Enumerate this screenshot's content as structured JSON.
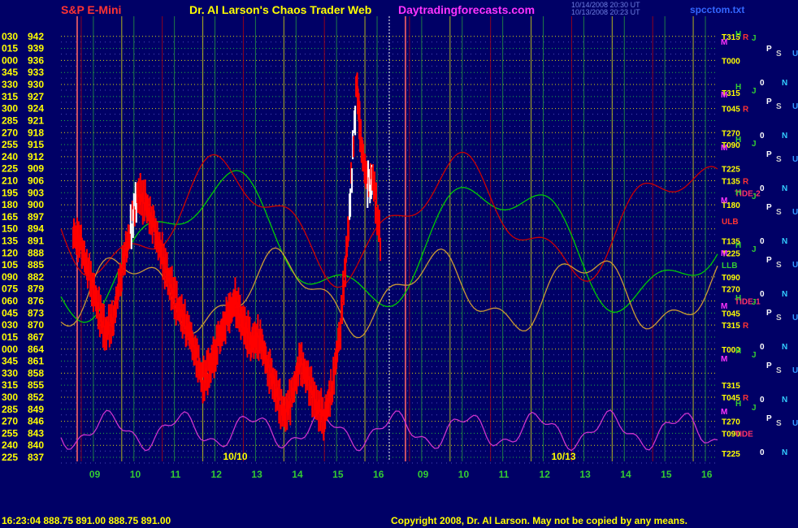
{
  "header": {
    "symbol": "S&P E-Mini",
    "title": "Dr. Al Larson's Chaos Trader Web",
    "site": "Daytradingforecasts.com",
    "timestamp_line1": "10/14/2008 20:30 UT",
    "timestamp_line2": "10/13/2008 20:23 UT",
    "filename": "spcctom.txt"
  },
  "footer": {
    "quote": "16:23:04  888.75 891.00 888.75 891.00",
    "copyright": "Copyright 2008, Dr. Al Larson. May not be copied by any means."
  },
  "colors": {
    "background": "#000066",
    "price_bars": "#ff0000",
    "up_bars": "#ffffff",
    "grid_yellow": "#ffff00",
    "grid_green": "#33cc33",
    "cycle_green": "#00cc00",
    "cycle_red": "#cc0000",
    "cycle_magenta": "#cc33cc",
    "axis_text": "#ffff00",
    "hour_text": "#33cc33"
  },
  "chart_data": {
    "type": "line",
    "title": "S&P E-Mini",
    "y_range": [
      837,
      945
    ],
    "y_tick_labels": [
      {
        "angle": "030",
        "price": "942"
      },
      {
        "angle": "015",
        "price": "939"
      },
      {
        "angle": "000",
        "price": "936"
      },
      {
        "angle": "345",
        "price": "933"
      },
      {
        "angle": "330",
        "price": "930"
      },
      {
        "angle": "315",
        "price": "927"
      },
      {
        "angle": "300",
        "price": "924"
      },
      {
        "angle": "285",
        "price": "921"
      },
      {
        "angle": "270",
        "price": "918"
      },
      {
        "angle": "255",
        "price": "915"
      },
      {
        "angle": "240",
        "price": "912"
      },
      {
        "angle": "225",
        "price": "909"
      },
      {
        "angle": "210",
        "price": "906"
      },
      {
        "angle": "195",
        "price": "903"
      },
      {
        "angle": "180",
        "price": "900"
      },
      {
        "angle": "165",
        "price": "897"
      },
      {
        "angle": "150",
        "price": "894"
      },
      {
        "angle": "135",
        "price": "891"
      },
      {
        "angle": "120",
        "price": "888"
      },
      {
        "angle": "105",
        "price": "885"
      },
      {
        "angle": "090",
        "price": "882"
      },
      {
        "angle": "075",
        "price": "879"
      },
      {
        "angle": "060",
        "price": "876"
      },
      {
        "angle": "045",
        "price": "873"
      },
      {
        "angle": "030",
        "price": "870"
      },
      {
        "angle": "015",
        "price": "867"
      },
      {
        "angle": "000",
        "price": "864"
      },
      {
        "angle": "345",
        "price": "861"
      },
      {
        "angle": "330",
        "price": "858"
      },
      {
        "angle": "315",
        "price": "855"
      },
      {
        "angle": "300",
        "price": "852"
      },
      {
        "angle": "285",
        "price": "849"
      },
      {
        "angle": "270",
        "price": "846"
      },
      {
        "angle": "255",
        "price": "843"
      },
      {
        "angle": "240",
        "price": "840"
      },
      {
        "angle": "225",
        "price": "837"
      }
    ],
    "x_hour_labels": [
      "09",
      "10",
      "11",
      "12",
      "13",
      "14",
      "15",
      "16",
      "09",
      "10",
      "11",
      "12",
      "13",
      "14",
      "15",
      "16"
    ],
    "session_labels": [
      "10/10",
      "10/13"
    ],
    "price_series": [
      {
        "hour": 8.5,
        "price": 893
      },
      {
        "hour": 8.7,
        "price": 890
      },
      {
        "hour": 8.9,
        "price": 882
      },
      {
        "hour": 9.1,
        "price": 875
      },
      {
        "hour": 9.3,
        "price": 868
      },
      {
        "hour": 9.5,
        "price": 872
      },
      {
        "hour": 9.7,
        "price": 884
      },
      {
        "hour": 9.9,
        "price": 893
      },
      {
        "hour": 10.1,
        "price": 903
      },
      {
        "hour": 10.3,
        "price": 900
      },
      {
        "hour": 10.5,
        "price": 894
      },
      {
        "hour": 10.7,
        "price": 887
      },
      {
        "hour": 10.9,
        "price": 880
      },
      {
        "hour": 11.1,
        "price": 874
      },
      {
        "hour": 11.3,
        "price": 870
      },
      {
        "hour": 11.5,
        "price": 864
      },
      {
        "hour": 11.7,
        "price": 856
      },
      {
        "hour": 11.9,
        "price": 860
      },
      {
        "hour": 12.1,
        "price": 866
      },
      {
        "hour": 12.3,
        "price": 872
      },
      {
        "hour": 12.5,
        "price": 876
      },
      {
        "hour": 12.7,
        "price": 870
      },
      {
        "hour": 12.9,
        "price": 866
      },
      {
        "hour": 13.1,
        "price": 867
      },
      {
        "hour": 13.3,
        "price": 860
      },
      {
        "hour": 13.5,
        "price": 854
      },
      {
        "hour": 13.7,
        "price": 847
      },
      {
        "hour": 13.9,
        "price": 852
      },
      {
        "hour": 14.1,
        "price": 861
      },
      {
        "hour": 14.3,
        "price": 856
      },
      {
        "hour": 14.5,
        "price": 850
      },
      {
        "hour": 14.7,
        "price": 847
      },
      {
        "hour": 14.9,
        "price": 855
      },
      {
        "hour": 15.1,
        "price": 870
      },
      {
        "hour": 15.3,
        "price": 895
      },
      {
        "hour": 15.5,
        "price": 930
      },
      {
        "hour": 15.6,
        "price": 916
      },
      {
        "hour": 15.75,
        "price": 905
      },
      {
        "hour": 15.9,
        "price": 906
      },
      {
        "hour": 16.1,
        "price": 890
      }
    ],
    "right_labels": [
      {
        "price": 942,
        "text": "T315",
        "suffix": "R"
      },
      {
        "price": 936,
        "text": "T000"
      },
      {
        "price": 928,
        "text": "T315"
      },
      {
        "price": 924,
        "text": "T045",
        "suffix": "R"
      },
      {
        "price": 918,
        "text": "T270"
      },
      {
        "price": 915,
        "text": "T090"
      },
      {
        "price": 909,
        "text": "T225"
      },
      {
        "price": 906,
        "text": "T135",
        "suffix": "R"
      },
      {
        "price": 903,
        "text": "TIDE-2"
      },
      {
        "price": 900,
        "text": "T180"
      },
      {
        "price": 896,
        "text": "ULB"
      },
      {
        "price": 891,
        "text": "T135"
      },
      {
        "price": 888,
        "text": "T225"
      },
      {
        "price": 885,
        "text": "LLB"
      },
      {
        "price": 882,
        "text": "T090"
      },
      {
        "price": 879,
        "text": "T270"
      },
      {
        "price": 876,
        "text": "TIDE-1"
      },
      {
        "price": 873,
        "text": "T045"
      },
      {
        "price": 870,
        "text": "T315",
        "suffix": "R"
      },
      {
        "price": 864,
        "text": "T000"
      },
      {
        "price": 855,
        "text": "T315"
      },
      {
        "price": 852,
        "text": "T045",
        "suffix": "R"
      },
      {
        "price": 846,
        "text": "T270"
      },
      {
        "price": 843,
        "text": "T090"
      },
      {
        "price": 843,
        "text": "TIDE"
      },
      {
        "price": 838,
        "text": "T225"
      }
    ],
    "grid": true,
    "legend": "right"
  }
}
